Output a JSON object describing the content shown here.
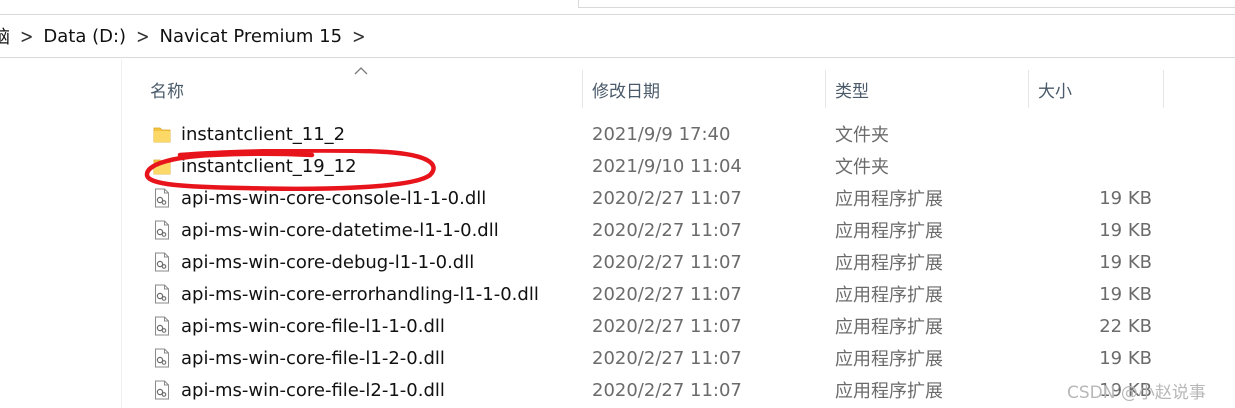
{
  "breadcrumb": {
    "partial_prefix": "脑",
    "items": [
      {
        "label": "Data (D:)"
      },
      {
        "label": "Navicat Premium 15"
      }
    ],
    "separator": ">"
  },
  "columns": {
    "name": "名称",
    "date": "修改日期",
    "type": "类型",
    "size": "大小"
  },
  "files": [
    {
      "name": "instantclient_11_2",
      "date": "2021/9/9 17:40",
      "type": "文件夹",
      "size": "",
      "icon": "folder-icon"
    },
    {
      "name": "instantclient_19_12",
      "date": "2021/9/10 11:04",
      "type": "文件夹",
      "size": "",
      "icon": "folder-icon"
    },
    {
      "name": "api-ms-win-core-console-l1-1-0.dll",
      "date": "2020/2/27 11:07",
      "type": "应用程序扩展",
      "size": "19 KB",
      "icon": "dll-file-icon"
    },
    {
      "name": "api-ms-win-core-datetime-l1-1-0.dll",
      "date": "2020/2/27 11:07",
      "type": "应用程序扩展",
      "size": "19 KB",
      "icon": "dll-file-icon"
    },
    {
      "name": "api-ms-win-core-debug-l1-1-0.dll",
      "date": "2020/2/27 11:07",
      "type": "应用程序扩展",
      "size": "19 KB",
      "icon": "dll-file-icon"
    },
    {
      "name": "api-ms-win-core-errorhandling-l1-1-0.dll",
      "date": "2020/2/27 11:07",
      "type": "应用程序扩展",
      "size": "19 KB",
      "icon": "dll-file-icon"
    },
    {
      "name": "api-ms-win-core-file-l1-1-0.dll",
      "date": "2020/2/27 11:07",
      "type": "应用程序扩展",
      "size": "22 KB",
      "icon": "dll-file-icon"
    },
    {
      "name": "api-ms-win-core-file-l1-2-0.dll",
      "date": "2020/2/27 11:07",
      "type": "应用程序扩展",
      "size": "19 KB",
      "icon": "dll-file-icon"
    },
    {
      "name": "api-ms-win-core-file-l2-1-0.dll",
      "date": "2020/2/27 11:07",
      "type": "应用程序扩展",
      "size": "19 KB",
      "icon": "dll-file-icon"
    }
  ],
  "colors": {
    "annotation": "#e8141b",
    "folder": "#f5c542",
    "header_text": "#4a5a6a"
  },
  "watermark": "CSDN @小赵说事"
}
